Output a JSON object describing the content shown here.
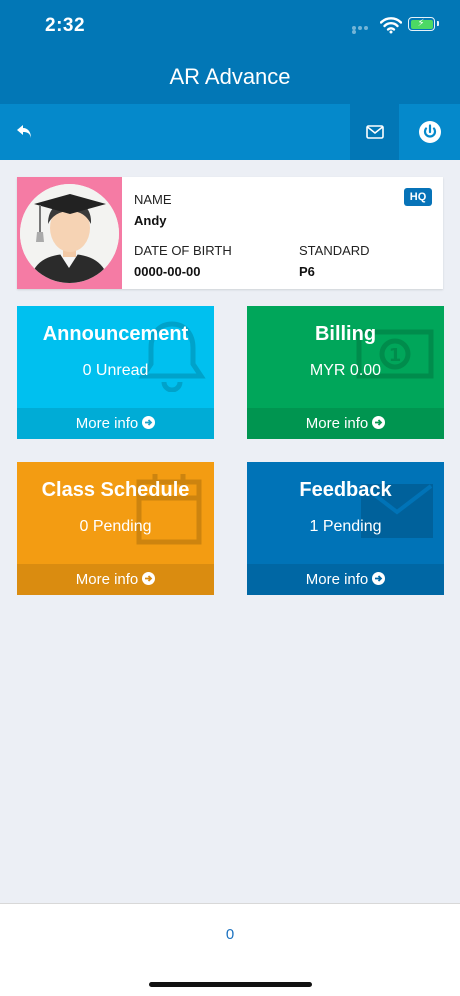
{
  "status_bar": {
    "time": "2:32"
  },
  "app": {
    "title": "AR Advance"
  },
  "profile": {
    "name_label": "NAME",
    "name": "Andy",
    "dob_label": "DATE OF BIRTH",
    "dob": "0000-00-00",
    "standard_label": "STANDARD",
    "standard": "P6",
    "badge": "HQ"
  },
  "tiles": [
    {
      "title": "Announcement",
      "subtitle": "0 Unread",
      "more": "More info",
      "color": "#00c0ef",
      "icon": "bell-icon"
    },
    {
      "title": "Billing",
      "subtitle": "MYR 0.00",
      "more": "More info",
      "color": "#00a65a",
      "icon": "money-icon"
    },
    {
      "title": "Class Schedule",
      "subtitle": "0 Pending",
      "more": "More info",
      "color": "#f39c12",
      "icon": "calendar-icon"
    },
    {
      "title": "Feedback",
      "subtitle": "1 Pending",
      "more": "More info",
      "color": "#0073b7",
      "icon": "envelope-icon"
    }
  ],
  "bottom_bar": {
    "count": "0"
  },
  "colors": {
    "header": "#0277b6",
    "toolbar": "#0589cb",
    "avatar_bg": "#f57ba4",
    "badge": "#0773b8"
  }
}
